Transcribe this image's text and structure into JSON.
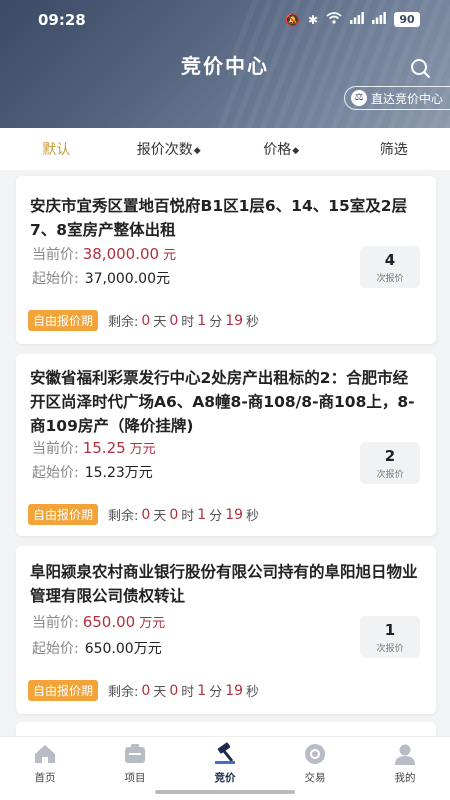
{
  "status": {
    "time": "09:28",
    "battery": "90"
  },
  "header": {
    "title": "竞价中心",
    "jump_label": "直达竞价中心"
  },
  "filters": [
    {
      "label": "默认",
      "active": true,
      "arrow": false
    },
    {
      "label": "报价次数",
      "active": false,
      "arrow": true
    },
    {
      "label": "价格",
      "active": false,
      "arrow": true
    },
    {
      "label": "筛选",
      "active": false,
      "arrow": false
    }
  ],
  "labels": {
    "current_price": "当前价:",
    "start_price": "起始价:",
    "bid_count": "次报价",
    "free_bid": "自由报价期",
    "remaining": "剩余:",
    "day": "天",
    "hour": "时",
    "minute": "分",
    "second": "秒"
  },
  "listings": [
    {
      "title": "安庆市宜秀区置地百悦府B1区1层6、14、15室及2层7、8室房产整体出租",
      "current_price": "38,000.00",
      "current_unit": "元",
      "start_price": "37,000.00元",
      "bids": "4",
      "days": "0",
      "hours": "0",
      "minutes": "1",
      "seconds": "19"
    },
    {
      "title": "安徽省福利彩票发行中心2处房产出租标的2：合肥市经开区尚泽时代广场A6、A8幢8-商108/8-商108上，8-商109房产（降价挂牌)",
      "current_price": "15.25",
      "current_unit": "万元",
      "start_price": "15.23万元",
      "bids": "2",
      "days": "0",
      "hours": "0",
      "minutes": "1",
      "seconds": "19"
    },
    {
      "title": "阜阳颍泉农村商业银行股份有限公司持有的阜阳旭日物业管理有限公司债权转让",
      "current_price": "650.00",
      "current_unit": "万元",
      "start_price": "650.00万元",
      "bids": "1",
      "days": "0",
      "hours": "0",
      "minutes": "1",
      "seconds": "19"
    }
  ],
  "tabs": [
    {
      "label": "首页",
      "icon": "home-icon"
    },
    {
      "label": "项目",
      "icon": "project-icon"
    },
    {
      "label": "竞价",
      "icon": "bid-icon",
      "active": true
    },
    {
      "label": "交易",
      "icon": "trade-icon"
    },
    {
      "label": "我的",
      "icon": "user-icon"
    }
  ],
  "colors": {
    "accent": "#c89a3c",
    "price": "#b1303f",
    "tag": "#f2a33a",
    "header": "#3a4a66"
  }
}
